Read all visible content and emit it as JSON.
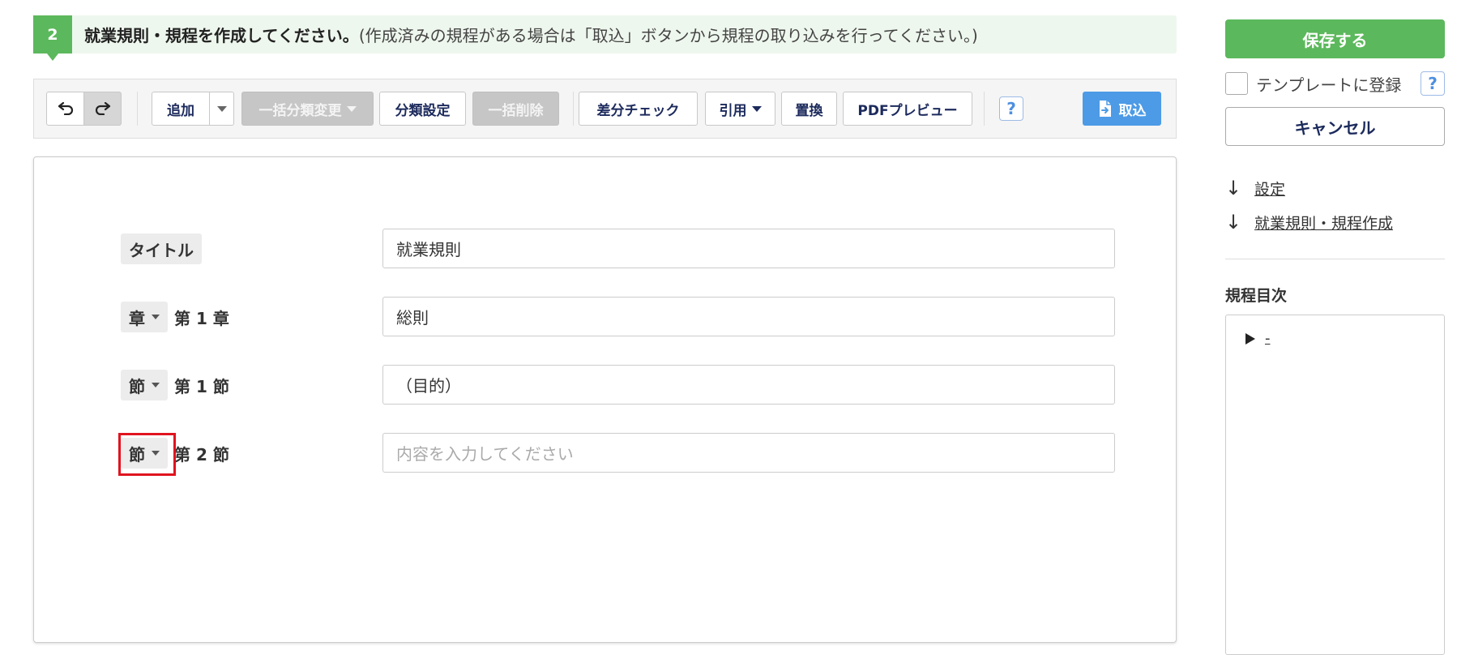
{
  "step": {
    "number": "2",
    "title": "就業規則・規程を作成してください。",
    "note": "(作成済みの規程がある場合は「取込」ボタンから規程の取り込みを行ってください。)"
  },
  "toolbar": {
    "undo_icon": "undo-icon",
    "redo_icon": "redo-icon",
    "add_label": "追加",
    "bulk_category_label": "一括分類変更",
    "category_settings_label": "分類設定",
    "bulk_delete_label": "一括削除",
    "diff_check_label": "差分チェック",
    "quote_label": "引用",
    "replace_label": "置換",
    "pdf_preview_label": "PDFプレビュー",
    "help_label": "?",
    "import_label": "取込"
  },
  "editor": {
    "rows": [
      {
        "tag": "タイトル",
        "number": "",
        "value": "就業規則",
        "placeholder": ""
      },
      {
        "tag": "章",
        "number": "第 1 章",
        "value": "総則",
        "placeholder": ""
      },
      {
        "tag": "節",
        "number": "第 1 節",
        "value": "（目的）",
        "placeholder": ""
      },
      {
        "tag": "節",
        "number": "第 2 節",
        "value": "",
        "placeholder": "内容を入力してください"
      }
    ]
  },
  "sidebar": {
    "save_label": "保存する",
    "template_label": "テンプレートに登録",
    "help_label": "?",
    "cancel_label": "キャンセル",
    "links": [
      "設定",
      "就業規則・規程作成"
    ],
    "toc_title": "規程目次",
    "toc_items": [
      "-"
    ]
  },
  "colors": {
    "accent_green": "#5cb85c",
    "primary_blue": "#4d9be6",
    "highlight_red": "#e0141f"
  }
}
